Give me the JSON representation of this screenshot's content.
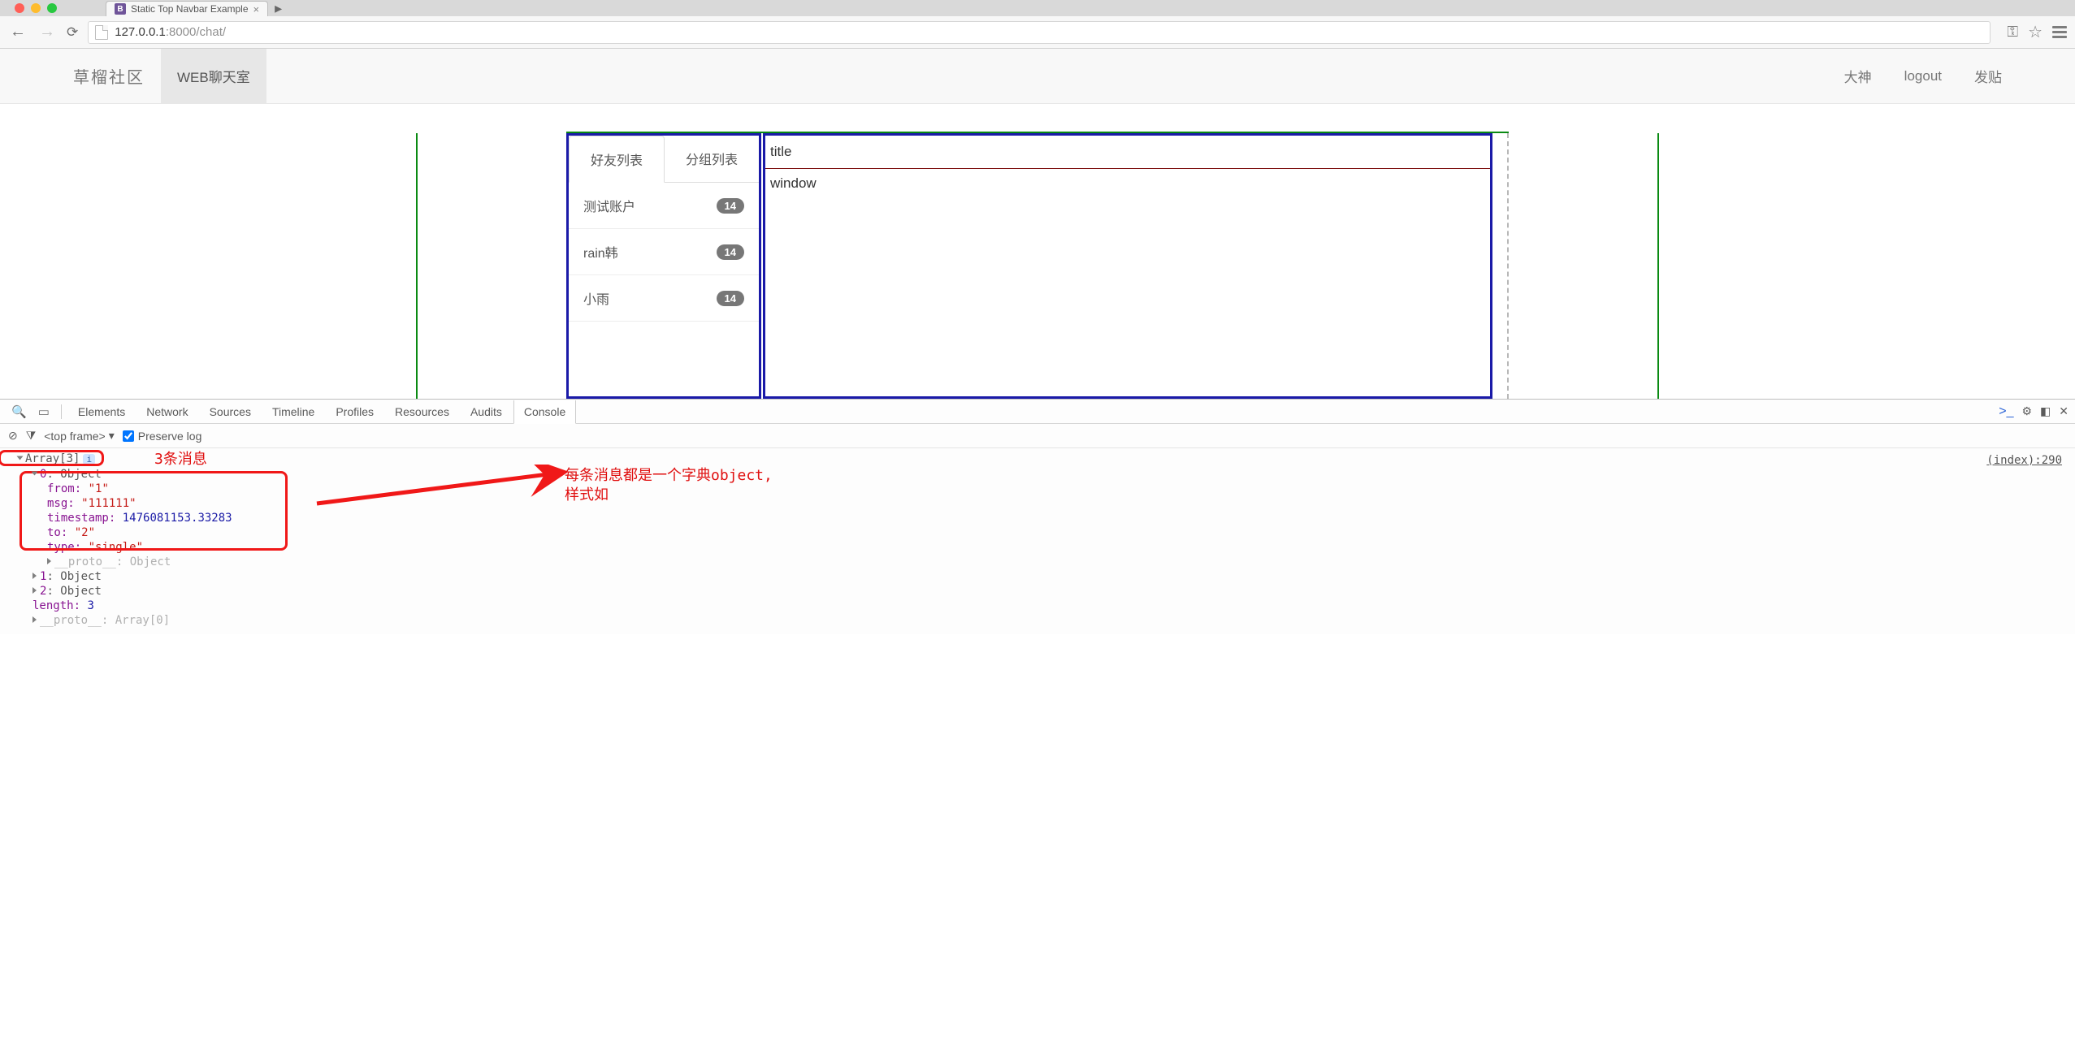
{
  "browser": {
    "tab_title": "Static Top Navbar Example",
    "url_host": "127.0.0.1",
    "url_port": ":8000",
    "url_path": "/chat/"
  },
  "navbar": {
    "brand": "草榴社区",
    "active_item": "WEB聊天室",
    "right_items": [
      "大神",
      "logout",
      "发贴"
    ]
  },
  "chat": {
    "tabs": [
      "好友列表",
      "分组列表"
    ],
    "friends": [
      {
        "name": "测试账户",
        "badge": "14"
      },
      {
        "name": "rain韩",
        "badge": "14"
      },
      {
        "name": "小雨",
        "badge": "14"
      }
    ],
    "title_label": "title",
    "window_label": "window"
  },
  "devtools": {
    "tabs": [
      "Elements",
      "Network",
      "Sources",
      "Timeline",
      "Profiles",
      "Resources",
      "Audits",
      "Console"
    ],
    "active_tab": "Console",
    "frame_selector": "<top frame>",
    "preserve_log_label": "Preserve log",
    "source_link": "(index):290"
  },
  "console": {
    "array_header": "Array[3]",
    "obj0_header": "0: Object",
    "msg_from_key": "from:",
    "msg_from_val": "\"1\"",
    "msg_msg_key": "msg:",
    "msg_msg_val": "\"111111\"",
    "msg_ts_key": "timestamp:",
    "msg_ts_val": "1476081153.33283",
    "msg_to_key": "to:",
    "msg_to_val": "\"2\"",
    "msg_type_key": "type:",
    "msg_type_val": "\"single\"",
    "proto0": "__proto__: Object",
    "obj1": "1: Object",
    "obj2": "2: Object",
    "length_key": "length:",
    "length_val": "3",
    "proto_arr": "__proto__: Array[0]"
  },
  "annotations": {
    "three_msgs": "3条消息",
    "each_msg_l1": "每条消息都是一个字典object,",
    "each_msg_l2": "样式如"
  }
}
